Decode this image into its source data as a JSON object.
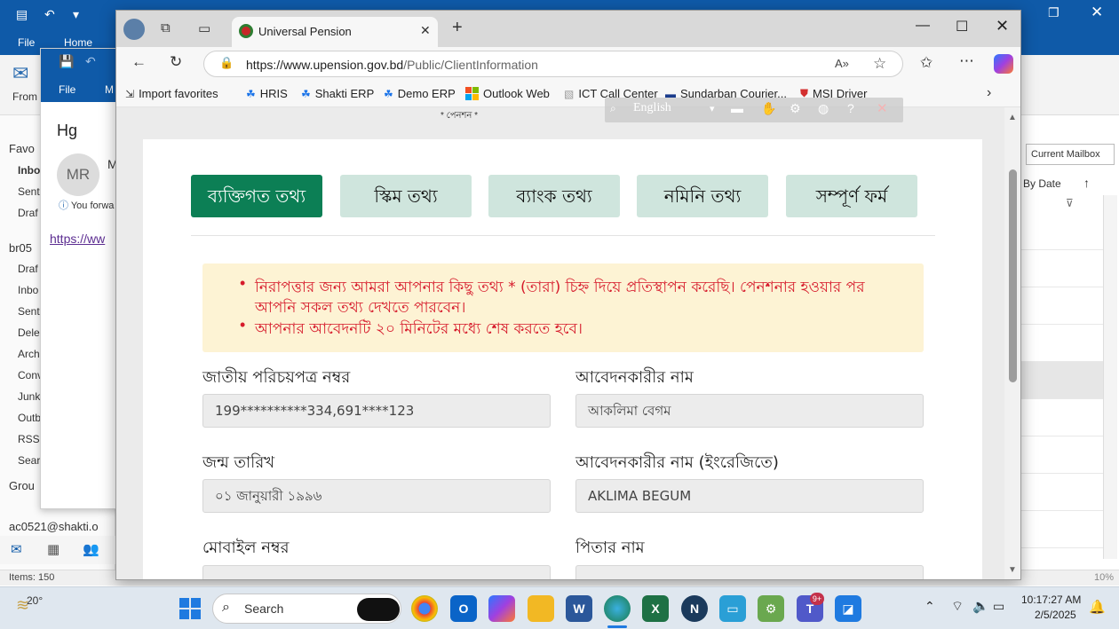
{
  "outlook": {
    "menu_file": "File",
    "menu_home": "Home",
    "from_label": "From",
    "favorites": "Favo",
    "inbox": "Inbo",
    "sent": "Sent",
    "drafts": "Draf",
    "account": "br05",
    "folders": [
      "Draf",
      "Inbo",
      "Sent",
      "Dele",
      "Arch",
      "Conv",
      "Junk",
      "Outb",
      "RSS",
      "Sear"
    ],
    "groups": "Grou",
    "account_email": "ac0521@shakti.o",
    "current_mailbox": "Current Mailbox",
    "sort_by": "By Date",
    "items_count": "Items: 150",
    "zoom": "10%"
  },
  "mail_window": {
    "menu_file": "File",
    "menu_m": "M",
    "subject": "Hg",
    "avatar_initials": "MR",
    "sender_initial": "M",
    "forward_note": "You forwa",
    "link_text": "https://ww"
  },
  "browser": {
    "tab_title": "Universal Pension",
    "url_host": "https://www.upension.gov.bd",
    "url_path": "/Public/ClientInformation",
    "favorites": [
      "Import favorites",
      "HRIS",
      "Shakti ERP",
      "Demo ERP",
      "Outlook Web",
      "ICT Call Center",
      "Sundarban Courier...",
      "MSI Driver"
    ],
    "translate_lang": "English",
    "page_header_fragment": "* পেনশন *"
  },
  "form": {
    "tabs": [
      "ব্যক্তিগত তথ্য",
      "স্কিম তথ্য",
      "ব্যাংক তথ্য",
      "নমিনি তথ্য",
      "সম্পূর্ণ ফর্ম"
    ],
    "notice_line1": "নিরাপত্তার জন্য আমরা আপনার কিছু তথ্য * (তারা) চিহ্ন দিয়ে প্রতিস্থাপন করেছি। পেনশনার হওয়ার পর",
    "notice_line1b": "আপনি সকল তথ্য দেখতে পারবেন।",
    "notice_line2": "আপনার আবেদনটি ২০ মিনিটের মধ্যে শেষ করতে হবে।",
    "nid_label": "জাতীয় পরিচয়পত্র নম্বর",
    "nid_value": "199**********334,691****123",
    "applicant_name_label": "আবেদনকারীর নাম",
    "applicant_name_value": "আকলিমা বেগম",
    "dob_label": "জন্ম তারিখ",
    "dob_value": "০১ জানুয়ারী ১৯৯৬",
    "applicant_name_en_label": "আবেদনকারীর নাম (ইংরেজিতে)",
    "applicant_name_en_value": "AKLIMA BEGUM",
    "mobile_label": "মোবাইল নম্বর",
    "father_label": "পিতার নাম"
  },
  "taskbar": {
    "weather_temp": "20°",
    "search_placeholder": "Search",
    "time": "10:17:27 AM",
    "date": "2/5/2025",
    "teams_badge": "9+"
  }
}
